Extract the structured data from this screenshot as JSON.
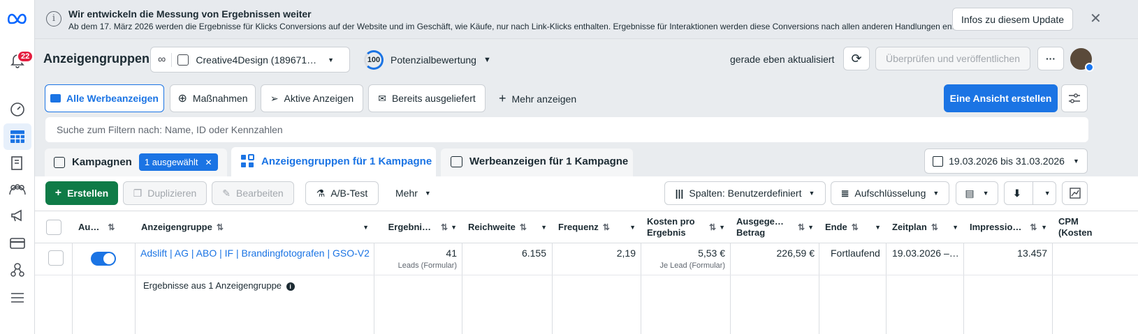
{
  "sidebar": {
    "notification_count": "22"
  },
  "banner": {
    "title": "Wir entwickeln die Messung von Ergebnissen weiter",
    "text": "Ab dem 17. März 2026 werden die Ergebnisse für Klicks Conversions auf der Website und im Geschäft, wie Käufe, nur nach Link-Klicks enthalten. Ergebnisse für Interaktionen werden diese Conversions nach allen anderen Handlungen enthalten.",
    "button": "Infos zu diesem Update"
  },
  "header": {
    "title": "Anzeigengruppen",
    "account": "Creative4Design (189671…",
    "score": "100",
    "score_label": "Potenzialbewertung",
    "updated": "gerade eben aktualisiert",
    "publish": "Überprüfen und veröffentlichen",
    "more": "···"
  },
  "views": {
    "items": [
      "Alle Werbeanzeigen",
      "Maßnahmen",
      "Aktive Anzeigen",
      "Bereits ausgeliefert"
    ],
    "more": "Mehr anzeigen",
    "create_view": "Eine Ansicht erstellen"
  },
  "search": {
    "placeholder": "Suche zum Filtern nach: Name, ID oder Kennzahlen"
  },
  "tabs": {
    "campaigns": "Kampagnen",
    "selected_chip": "1 ausgewählt",
    "adsets": "Anzeigengruppen für 1 Kampagne",
    "ads": "Werbeanzeigen für 1 Kampagne",
    "date_range": "19.03.2026 bis 31.03.2026"
  },
  "toolbar": {
    "create": "Erstellen",
    "duplicate": "Duplizieren",
    "edit": "Bearbeiten",
    "abtest": "A/B-Test",
    "more": "Mehr",
    "columns": "Spalten: Benutzerdefiniert",
    "breakdown": "Aufschlüsselung"
  },
  "table": {
    "headers": {
      "onoff": "Au…",
      "name": "Anzeigengruppe",
      "results": "Ergebni…",
      "reach": "Reichweite",
      "frequency": "Frequenz",
      "cost_per_result_1": "Kosten pro",
      "cost_per_result_2": "Ergebnis",
      "spent_1": "Ausgege…",
      "spent_2": "Betrag",
      "end": "Ende",
      "schedule": "Zeitplan",
      "impressions": "Impressio…",
      "cpm_1": "CPM",
      "cpm_2": "(Kosten"
    },
    "row": {
      "name": "Adslift | AG | ABO | IF | Brandingfotografen | GSO-V2",
      "results": "41",
      "results_sub": "Leads (Formular)",
      "reach": "6.155",
      "frequency": "2,19",
      "cost_per_result": "5,53 €",
      "cost_sub": "Je Lead (Formular)",
      "spent": "226,59 €",
      "end": "Fortlaufend",
      "schedule": "19.03.2026 –…",
      "impressions": "13.457"
    },
    "summary": "Ergebnisse aus 1 Anzeigengruppe"
  }
}
